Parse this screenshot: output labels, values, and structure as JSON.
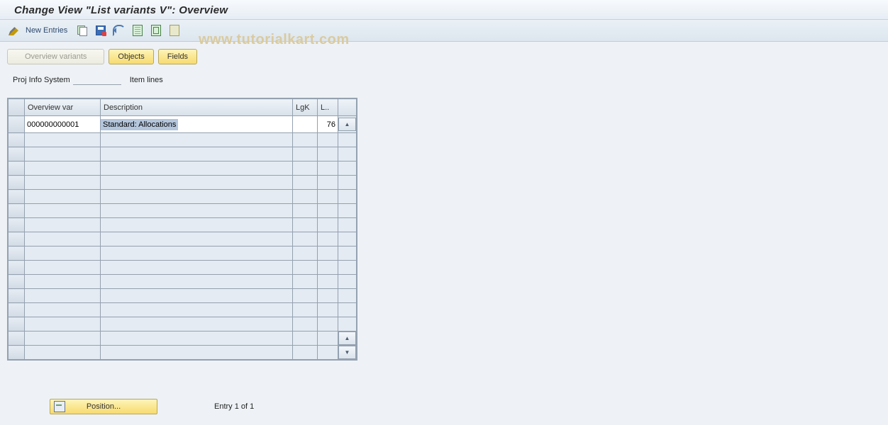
{
  "title": "Change View \"List variants                    V\": Overview",
  "toolbar": {
    "new_entries": "New Entries"
  },
  "tabs": {
    "overview_variants": "Overview variants",
    "objects": "Objects",
    "fields": "Fields"
  },
  "info": {
    "label1": "Proj Info System",
    "label2": "Item lines"
  },
  "grid": {
    "headers": {
      "overview_var": "Overview var",
      "description": "Description",
      "lgk": "LgK",
      "l": "L.."
    },
    "rows": [
      {
        "overview_var": "000000000001",
        "description": "Standard: Allocations",
        "lgk": "",
        "l": "76"
      }
    ]
  },
  "footer": {
    "position": "Position...",
    "entry": "Entry 1 of 1"
  },
  "watermark": "www.tutorialkart.com"
}
